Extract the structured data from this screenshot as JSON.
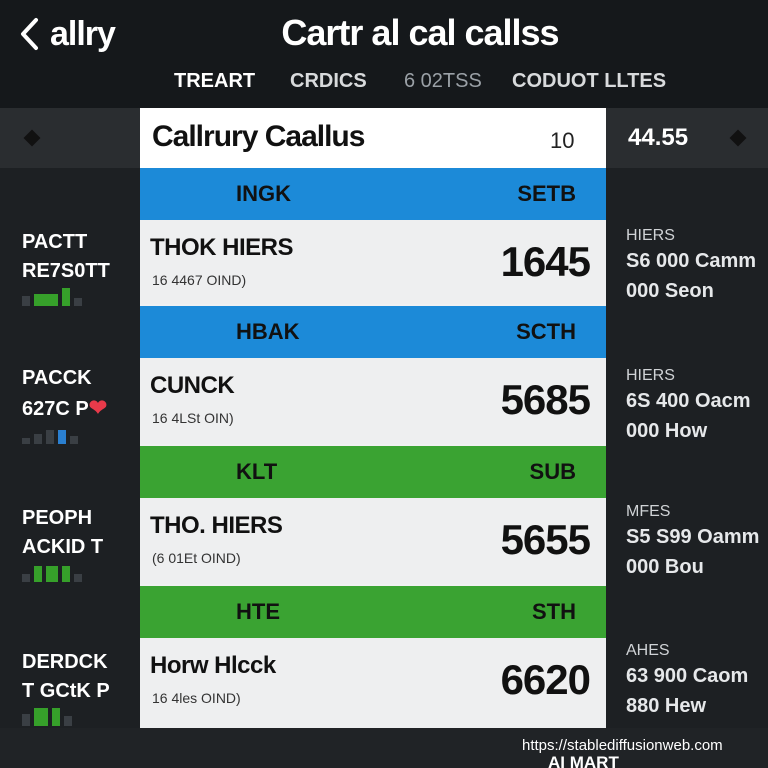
{
  "header": {
    "back_label": "allry",
    "title": "Cartr al cal callss",
    "tabs": [
      "TREART",
      "CRDICS",
      "6 02TSS",
      "CODUOT LLTES"
    ]
  },
  "strip": {
    "value": "44.55"
  },
  "panel": {
    "title": "Callrury Caallus",
    "count": "10",
    "sections": [
      {
        "left": "INGK",
        "right": "SETB",
        "color": "blue",
        "name": "THOK HIERS",
        "sub": "16 4467 OIND)",
        "value": "1645"
      },
      {
        "left": "HBAK",
        "right": "SCTH",
        "color": "blue",
        "name": "CUNCK",
        "sub": "16 4LSt OIN)",
        "value": "5685"
      },
      {
        "left": "KLT",
        "right": "SUB",
        "color": "green",
        "name": "THO. HIERS",
        "sub": "(6 01Et OIND)",
        "value": "5655"
      },
      {
        "left": "HTE",
        "right": "STH",
        "color": "green",
        "name": "Horw Hlcck",
        "sub": "16 4les OIND)",
        "value": "6620"
      }
    ]
  },
  "left_items": [
    {
      "l1": "PACTT",
      "l2": "RE7S0TT"
    },
    {
      "l1": "PACCK",
      "l2": "627C P"
    },
    {
      "l1": "PEOPH",
      "l2": "ACKID T"
    },
    {
      "l1": "DERDCK",
      "l2": "T GCtK P"
    }
  ],
  "right_items": [
    {
      "r0": "HIERS",
      "r1": "S6 000 Camm",
      "r2": "000 Seon"
    },
    {
      "r0": "HIERS",
      "r1": "6S 400 Oacm",
      "r2": "000 How"
    },
    {
      "r0": "MFES",
      "r1": "S5 S99 Oamm",
      "r2": "000 Bou"
    },
    {
      "r0": "AHES",
      "r1": "63 900 Caom",
      "r2": "880 Hew"
    }
  ],
  "footer": {
    "url": "https://stablediffusionweb.com",
    "brand": "AI MART"
  },
  "colors": {
    "blue": "#1c8ad8",
    "green": "#3aa332",
    "heart": "#e83a4a"
  },
  "icons": [
    "chevron-left-icon",
    "heart-icon"
  ]
}
